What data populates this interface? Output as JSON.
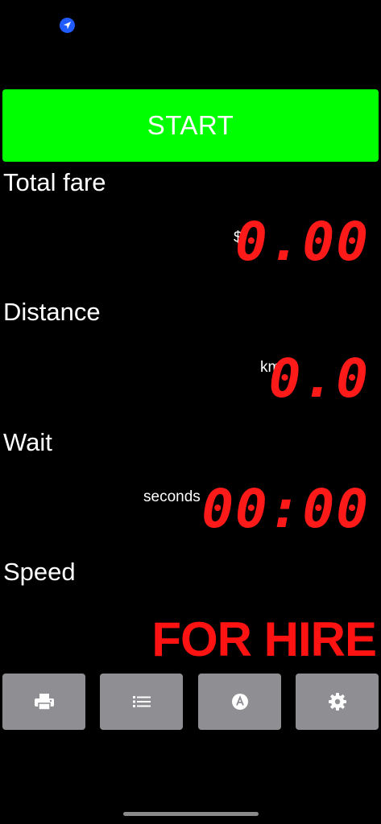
{
  "status_bar": {
    "icon": "location-arrow-icon"
  },
  "start_button": {
    "label": "START",
    "color": "#00ff00"
  },
  "fare": {
    "label": "Total fare",
    "unit": "$",
    "value": "0.00"
  },
  "distance": {
    "label": "Distance",
    "unit": "km",
    "value": "0.0"
  },
  "wait": {
    "label": "Wait",
    "unit": "seconds",
    "value": "00:00"
  },
  "speed": {
    "label": "Speed"
  },
  "status": {
    "text": "FOR HIRE",
    "color": "#ff1212"
  },
  "toolbar": {
    "buttons": [
      {
        "name": "print",
        "icon": "printer-icon"
      },
      {
        "name": "list",
        "icon": "list-icon"
      },
      {
        "name": "auto",
        "icon": "letter-a-circle-icon"
      },
      {
        "name": "settings",
        "icon": "gear-icon"
      }
    ]
  },
  "colors": {
    "background": "#000000",
    "digits": "#ff1a1a",
    "button_gray": "#8e8e93"
  }
}
